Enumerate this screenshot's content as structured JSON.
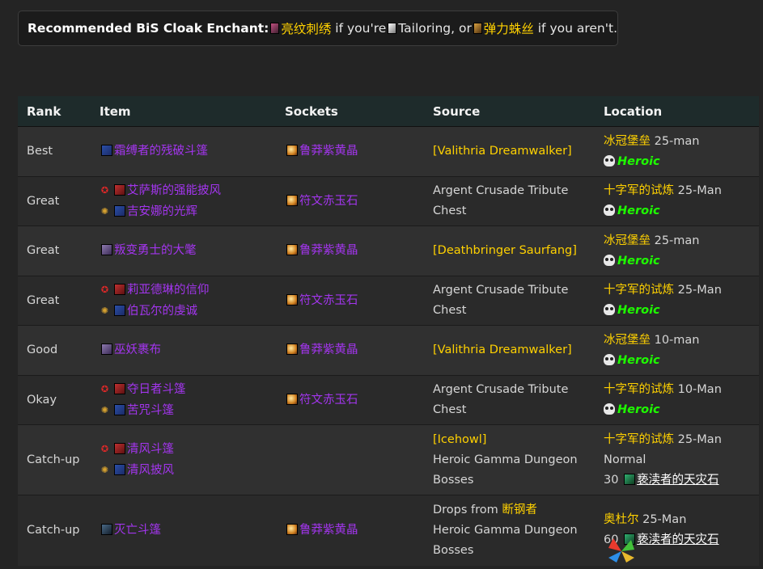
{
  "enchant": {
    "label": "Recommended BiS Cloak Enchant",
    "colon": ":",
    "primary": "亮纹刺绣",
    "mid1": "if you're",
    "profession": "Tailoring",
    "mid2": ", or",
    "secondary": "弹力蛛丝",
    "mid3": "if you aren't."
  },
  "table": {
    "headers": [
      "Rank",
      "Item",
      "Sockets",
      "Source",
      "Location"
    ],
    "rows": [
      {
        "rank": "Best",
        "items": [
          {
            "faction": "",
            "name": "霜缚者的残破斗篷",
            "icon": "cloak-blue"
          }
        ],
        "socket": "鲁莽紫黄晶",
        "source_lines": [
          {
            "text": "[Valithria Dreamwalker]",
            "style": "gold"
          }
        ],
        "location": {
          "zone": "冰冠堡垒",
          "size": "25-man",
          "difficulty": "Heroic",
          "extra": []
        }
      },
      {
        "rank": "Great",
        "items": [
          {
            "faction": "horde",
            "name": "艾萨斯的强能披风",
            "icon": "cloak-red"
          },
          {
            "faction": "alliance",
            "name": "吉安娜的光辉",
            "icon": "cloak-blue"
          }
        ],
        "socket": "符文赤玉石",
        "source_lines": [
          {
            "text": "Argent Crusade Tribute",
            "style": ""
          },
          {
            "text": "Chest",
            "style": ""
          }
        ],
        "location": {
          "zone": "十字军的试炼",
          "size": "25-Man",
          "difficulty": "Heroic",
          "extra": []
        }
      },
      {
        "rank": "Great",
        "items": [
          {
            "faction": "",
            "name": "叛变勇士的大氅",
            "icon": "cloak-dark"
          }
        ],
        "socket": "鲁莽紫黄晶",
        "source_lines": [
          {
            "text": "[Deathbringer Saurfang]",
            "style": "gold"
          }
        ],
        "location": {
          "zone": "冰冠堡垒",
          "size": "25-man",
          "difficulty": "Heroic",
          "extra": []
        }
      },
      {
        "rank": "Great",
        "items": [
          {
            "faction": "horde",
            "name": "莉亚德琳的信仰",
            "icon": "cloak-red"
          },
          {
            "faction": "alliance",
            "name": "伯瓦尔的虔诚",
            "icon": "cloak-blue"
          }
        ],
        "socket": "符文赤玉石",
        "source_lines": [
          {
            "text": "Argent Crusade Tribute",
            "style": ""
          },
          {
            "text": "Chest",
            "style": ""
          }
        ],
        "location": {
          "zone": "十字军的试炼",
          "size": "25-Man",
          "difficulty": "Heroic",
          "extra": []
        }
      },
      {
        "rank": "Good",
        "items": [
          {
            "faction": "",
            "name": "巫妖裹布",
            "icon": "cloak-dark"
          }
        ],
        "socket": "鲁莽紫黄晶",
        "source_lines": [
          {
            "text": "[Valithria Dreamwalker]",
            "style": "gold"
          }
        ],
        "location": {
          "zone": "冰冠堡垒",
          "size": "10-man",
          "difficulty": "Heroic",
          "extra": []
        }
      },
      {
        "rank": "Okay",
        "items": [
          {
            "faction": "horde",
            "name": "夺日者斗篷",
            "icon": "cloak-red"
          },
          {
            "faction": "alliance",
            "name": "苦咒斗篷",
            "icon": "cloak-blue"
          }
        ],
        "socket": "符文赤玉石",
        "source_lines": [
          {
            "text": "Argent Crusade Tribute",
            "style": ""
          },
          {
            "text": "Chest",
            "style": ""
          }
        ],
        "location": {
          "zone": "十字军的试炼",
          "size": "10-Man",
          "difficulty": "Heroic",
          "extra": []
        }
      },
      {
        "rank": "Catch-up",
        "items": [
          {
            "faction": "horde",
            "name": "清风斗篷",
            "icon": "cloak-red"
          },
          {
            "faction": "alliance",
            "name": "清风披风",
            "icon": "cloak-blue"
          }
        ],
        "socket": "",
        "source_lines": [
          {
            "text": "[Icehowl]",
            "style": "gold"
          },
          {
            "text": "Heroic Gamma Dungeon",
            "style": ""
          },
          {
            "text": "Bosses",
            "style": ""
          }
        ],
        "location": {
          "zone": "十字军的试炼",
          "size": "25-Man",
          "difficulty": "",
          "extra": [
            "Normal"
          ],
          "cost": "30",
          "currency": "亵渎者的天灾石"
        }
      },
      {
        "rank": "Catch-up",
        "items": [
          {
            "faction": "",
            "name": "灭亡斗篷",
            "icon": "cloak-black"
          }
        ],
        "socket": "鲁莽紫黄晶",
        "source_lines": [
          {
            "text": "Drops from",
            "style": "",
            "suffix": "断钢者"
          },
          {
            "text": "Heroic Gamma Dungeon",
            "style": ""
          },
          {
            "text": "Bosses",
            "style": ""
          }
        ],
        "location": {
          "zone": "奥杜尔",
          "size": "25-Man",
          "difficulty": "",
          "extra": [],
          "cost": "60",
          "currency": "亵渎者的天灾石"
        }
      }
    ]
  },
  "colors": {
    "epic": "#a335ee",
    "quest": "#ffd100",
    "heroic": "#1eff00",
    "header_bg": "#1e2b2b"
  }
}
